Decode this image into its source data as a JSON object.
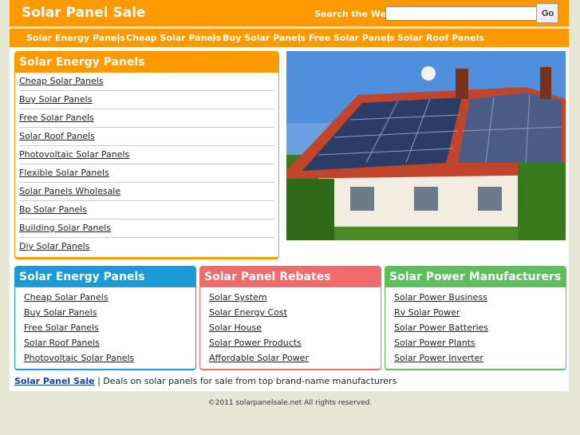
{
  "header": {
    "site_title": "Solar Panel Sale",
    "search_label": "Search the Web:",
    "search_value": "",
    "go_label": "Go"
  },
  "topnav": [
    "Solar Energy Panels",
    "Cheap Solar Panels",
    "Buy Solar Panels",
    "Free Solar Panels",
    "Solar Roof Panels"
  ],
  "left_panel": {
    "title": "Solar Energy Panels",
    "links": [
      "Cheap Solar Panels",
      "Buy Solar Panels",
      "Free Solar Panels",
      "Solar Roof Panels",
      "Photovoltaic Solar Panels",
      "Flexible Solar Panels",
      "Solar Panels Wholesale",
      "Bp Solar Panels",
      "Building Solar Panels",
      "Diy Solar Panels"
    ]
  },
  "boxes": [
    {
      "title": "Solar Energy Panels",
      "color": "#1a9ad6",
      "links": [
        "Cheap Solar Panels",
        "Buy Solar Panels",
        "Free Solar Panels",
        "Solar Roof Panels",
        "Photovoltaic Solar Panels"
      ]
    },
    {
      "title": "Solar Panel Rebates",
      "color": "#f06b6b",
      "links": [
        "Solar System",
        "Solar Energy Cost",
        "Solar House",
        "Solar Power Products",
        "Affordable Solar Power"
      ]
    },
    {
      "title": "Solar Power Manufacturers",
      "color": "#5cbf5c",
      "links": [
        "Solar Power Business",
        "Rv Solar Power",
        "Solar Power Batteries",
        "Solar Power Plants",
        "Solar Power Inverter"
      ]
    }
  ],
  "footer": {
    "link": "Solar Panel Sale",
    "text": " | Deals on solar panels for sale from top brand-name manufacturers",
    "copyright": "©2011 solarpanelsale.net All rights reserved."
  }
}
